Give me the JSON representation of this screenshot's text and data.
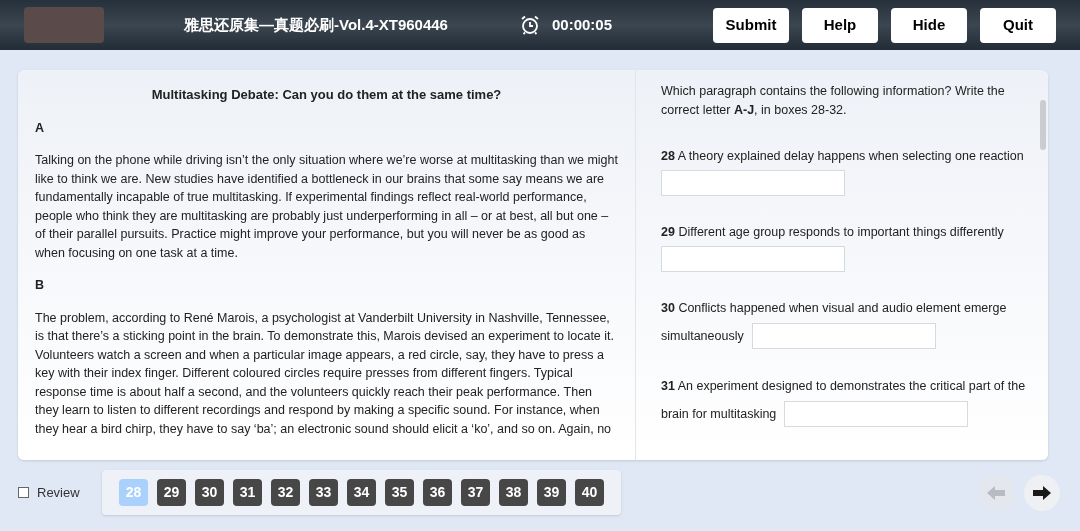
{
  "header": {
    "title": "雅思还原集—真题必刷-Vol.4-XT960446",
    "timer": "00:00:05",
    "buttons": [
      "Submit",
      "Help",
      "Hide",
      "Quit"
    ]
  },
  "passage": {
    "title": "Multitasking Debate: Can you do them at the same time?",
    "sections": [
      {
        "letter": "A",
        "text": "Talking on the phone while driving isn’t the only situation where we’re worse at multitasking than we might like to think we are. New studies have identified a bottleneck in our brains that some say means we are fundamentally incapable of true multitasking. If experimental findings reflect real-world performance, people who think they are multitasking are probably just underperforming in all – or at best, all but one – of their parallel pursuits. Practice might improve your performance, but you will never be as good as when focusing on one task at a time."
      },
      {
        "letter": "B",
        "text": "The problem, according to René Marois, a psychologist at Vanderbilt University in Nashville, Tennessee, is that there’s a sticking point in the brain. To demonstrate this, Marois devised an experiment to locate it. Volunteers watch a screen and when a particular image appears, a red circle, say, they have to press a key with their index finger. Different coloured circles require presses from different fingers. Typical response time is about half a second, and the volunteers quickly reach their peak performance. Then they learn to listen to different recordings and respond by making a specific sound. For instance, when they hear a bird chirp, they have to say ‘ba’; an electronic sound should elicit a ‘ko’, and so on. Again, no"
      }
    ]
  },
  "instructions": "Which paragraph contains the following information? Write the correct letter **A-J**, in boxes 28-32.",
  "questions": [
    {
      "number": "28",
      "text": "A theory explained delay happens when selecting one reaction"
    },
    {
      "number": "29",
      "text": "Different age group responds to important things differently"
    },
    {
      "number": "30",
      "text": "Conflicts happened when visual and audio element emerge",
      "text_continued": "simultaneously"
    },
    {
      "number": "31",
      "text": "An experiment designed to demonstrates the critical part of the",
      "text_continued": "brain for multitasking"
    }
  ],
  "footer": {
    "review": {
      "label": "Review",
      "checked": false
    },
    "pages": [
      {
        "label": "28",
        "selected": true
      },
      {
        "label": "29",
        "selected": false
      },
      {
        "label": "30",
        "selected": false
      },
      {
        "label": "31",
        "selected": false
      },
      {
        "label": "32",
        "selected": false
      },
      {
        "label": "33",
        "selected": false
      },
      {
        "label": "34",
        "selected": false
      },
      {
        "label": "35",
        "selected": false
      },
      {
        "label": "36",
        "selected": false
      },
      {
        "label": "37",
        "selected": false
      },
      {
        "label": "38",
        "selected": false
      },
      {
        "label": "39",
        "selected": false
      },
      {
        "label": "40",
        "selected": false
      }
    ],
    "prev": {
      "disabled": true
    },
    "next": {
      "disabled": false
    }
  }
}
